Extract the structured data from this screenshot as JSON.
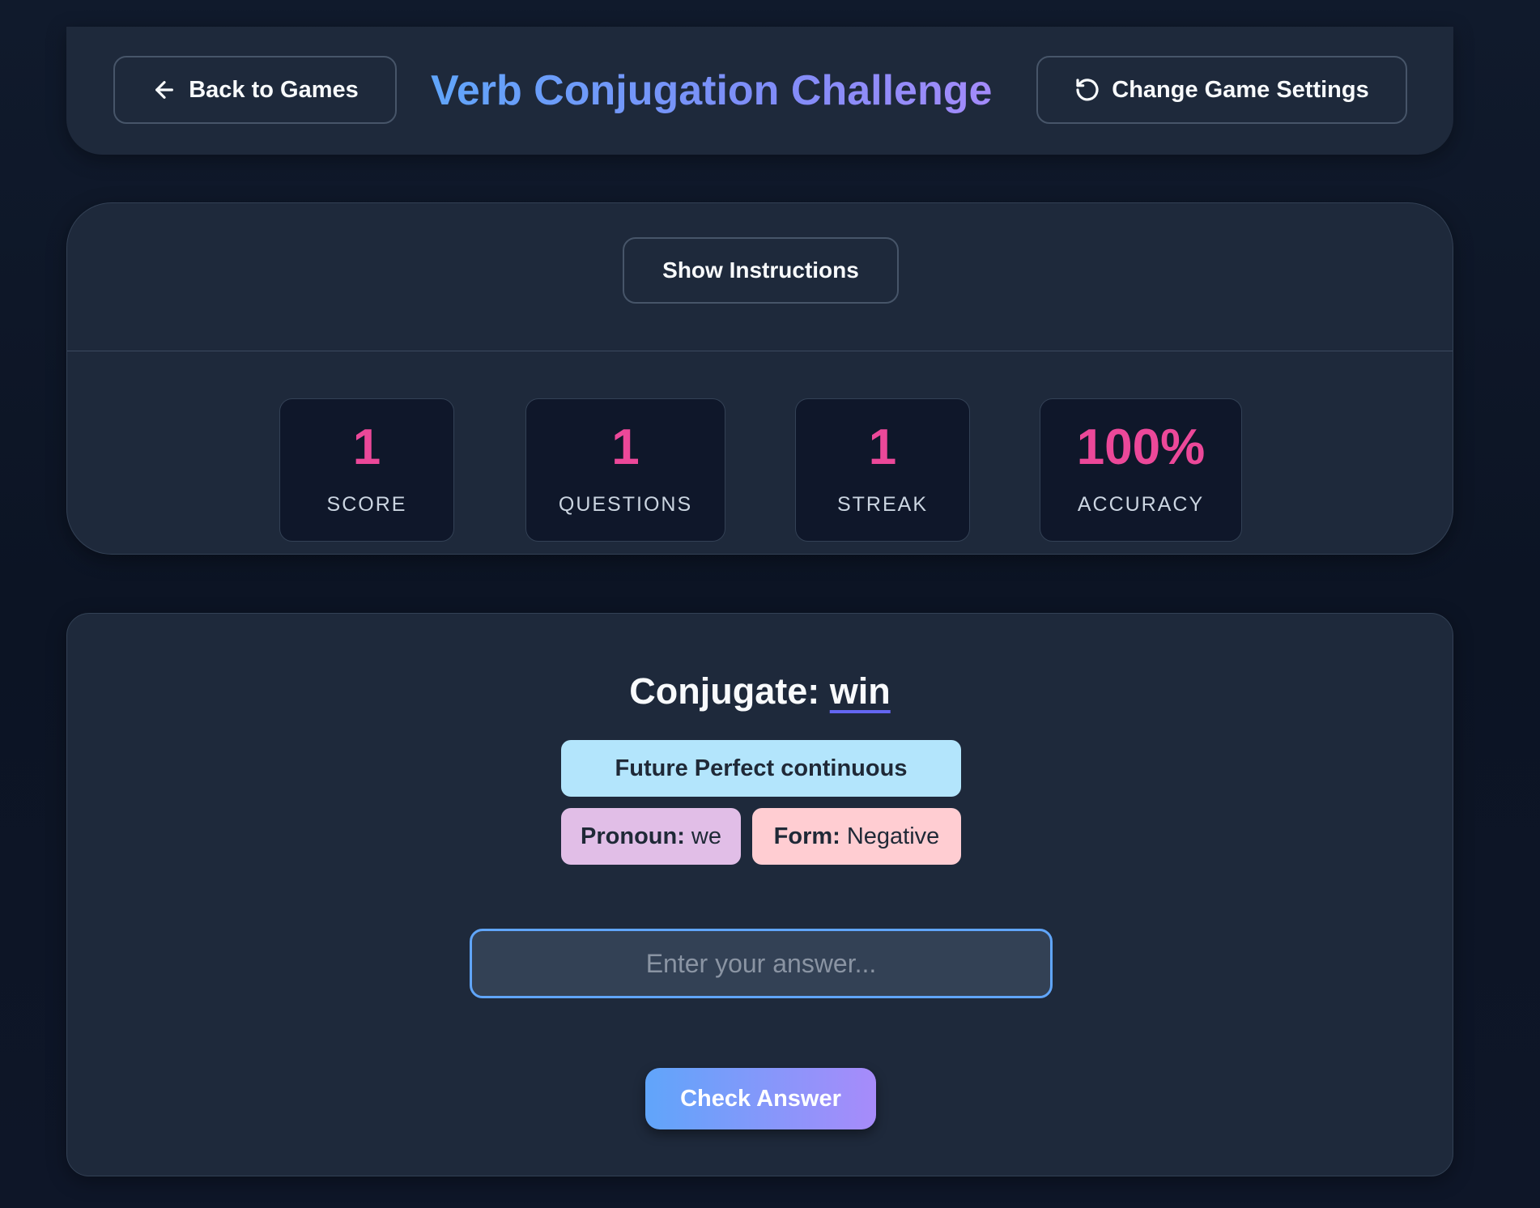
{
  "header": {
    "back_label": "Back to Games",
    "title": "Verb Conjugation Challenge",
    "settings_label": "Change Game Settings"
  },
  "instructions": {
    "label": "Show Instructions"
  },
  "stats": [
    {
      "value": "1",
      "label": "SCORE"
    },
    {
      "value": "1",
      "label": "QUESTIONS"
    },
    {
      "value": "1",
      "label": "STREAK"
    },
    {
      "value": "100%",
      "label": "ACCURACY"
    }
  ],
  "question": {
    "prompt": "Conjugate:",
    "verb": "win",
    "tense": "Future Perfect continuous",
    "pronoun_label": "Pronoun:",
    "pronoun": "we",
    "form_label": "Form:",
    "form": "Negative"
  },
  "answer": {
    "placeholder": "Enter your answer...",
    "value": ""
  },
  "check_label": "Check Answer",
  "colors": {
    "accent_pink": "#ec4899",
    "gradient_start": "#60a5fa",
    "gradient_end": "#a78bfa",
    "tense_tag": "#b3e5fc",
    "pronoun_tag": "#e1bee7",
    "form_tag": "#ffcdd2"
  },
  "icons": {
    "back": "arrow-left-icon",
    "settings": "rotate-ccw-icon"
  }
}
